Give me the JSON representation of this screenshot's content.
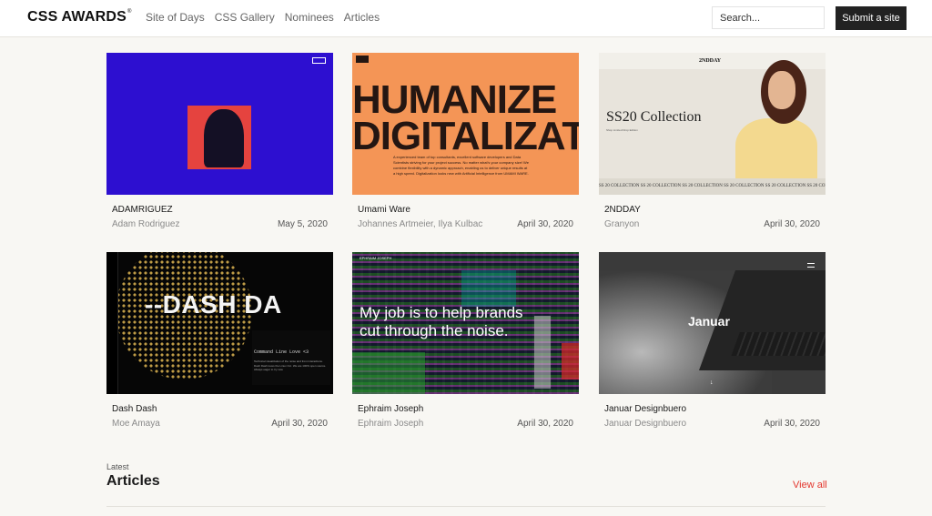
{
  "header": {
    "logo": "CSS AWARDS",
    "logo_mark": "®",
    "nav": [
      "Site of Days",
      "CSS Gallery",
      "Nominees",
      "Articles"
    ],
    "search_placeholder": "Search...",
    "submit_label": "Submit a site"
  },
  "cards": [
    {
      "title": "ADAMRIGUEZ",
      "author": "Adam Rodriguez",
      "date": "May 5, 2020"
    },
    {
      "title": "Umami Ware",
      "author": "Johannes Artmeier, Ilya Kulbac",
      "date": "April 30, 2020"
    },
    {
      "title": "2NDDAY",
      "author": "Granyon",
      "date": "April 30, 2020"
    },
    {
      "title": "Dash Dash",
      "author": "Moe Amaya",
      "date": "April 30, 2020"
    },
    {
      "title": "Ephraim Joseph",
      "author": "Ephraim Joseph",
      "date": "April 30, 2020"
    },
    {
      "title": "Januar Designbuero",
      "author": "Januar Designbuero",
      "date": "April 30, 2020"
    }
  ],
  "thumbnails": {
    "umami_line1": "HUMANIZE",
    "umami_line2": "DIGITALIZATIO",
    "umami_text": "A experienced team of top consultants, excellent software developers and Data Scientists striving for your project success. No matter what's your company size! We combine flexibility with a dynamic approach, enabling us to deliver unique results at a high speed. Digitalization looks new with Artificial Intelligence from UMAMI WARE.",
    "secondday_brand": "2NDDAY",
    "secondday_collection": "SS20 Collection",
    "secondday_sub": "Shop Limited Drop Edition",
    "secondday_strip": "SS 20 COLLECTION   SS 20 COLLECTION   SS 20 COLLECTION   SS 20 COLLECTION   SS 20 COLLECTION   SS 20 COLLECTION",
    "dash_heading": "--DASH DA",
    "dash_panel_title": "Command Line Love <3",
    "dash_panel_text": "Technical visualization of the noise and from interactions. Dash Dash loves the Linux CLI. We are 100% open source. Always eager to try new",
    "ephraim_top": "EPHRAIM JOSEPH",
    "ephraim_heading": "My job is to help brands cut through the noise.",
    "januar_heading": "Januar",
    "januar_arrow": "↓"
  },
  "section": {
    "latest": "Latest",
    "title": "Articles",
    "view_all": "View all"
  },
  "colors": {
    "accent": "#e3362d",
    "submit_bg": "#222222",
    "page_bg": "#f8f7f3"
  },
  "icons": [
    "hamburger-icon",
    "arrow-down-icon"
  ]
}
